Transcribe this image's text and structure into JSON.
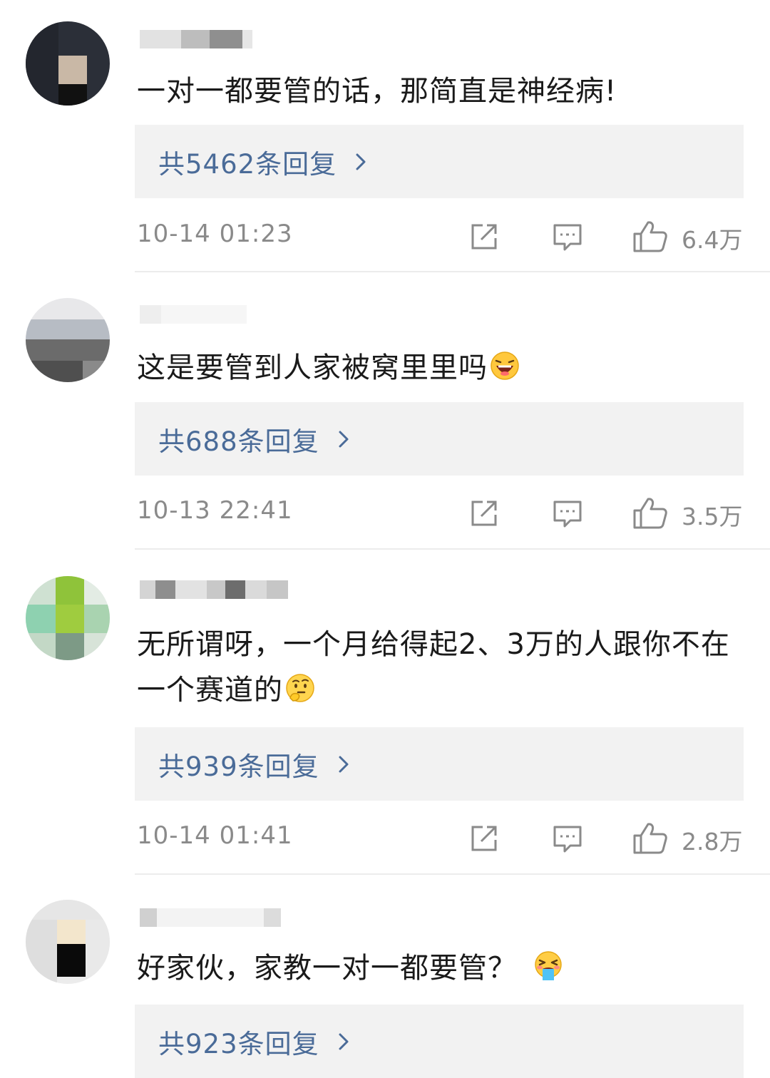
{
  "comments": [
    {
      "text": "一对一都要管的话，那简直是神经病!",
      "replies": "共5462条回复",
      "time": "10-14 01:23",
      "likes": "6.4万",
      "emoji": ""
    },
    {
      "text": "这是要管到人家被窝里里吗",
      "replies": "共688条回复",
      "time": "10-13 22:41",
      "likes": "3.5万",
      "emoji": "laughing-emoji-icon"
    },
    {
      "text": "无所谓呀，一个月给得起2、3万的人跟你不在一个赛道的",
      "replies": "共939条回复",
      "time": "10-14 01:41",
      "likes": "2.8万",
      "emoji": "thinking-emoji-icon"
    },
    {
      "text": "好家伙，家教一对一都要管？",
      "replies": "共923条回复",
      "time": "",
      "likes": "",
      "emoji": "vomiting-emoji-icon"
    }
  ],
  "colors": {
    "reply_link": "#4a6b98",
    "meta_text": "#8a8a8a",
    "reply_bg": "#f2f2f2"
  }
}
